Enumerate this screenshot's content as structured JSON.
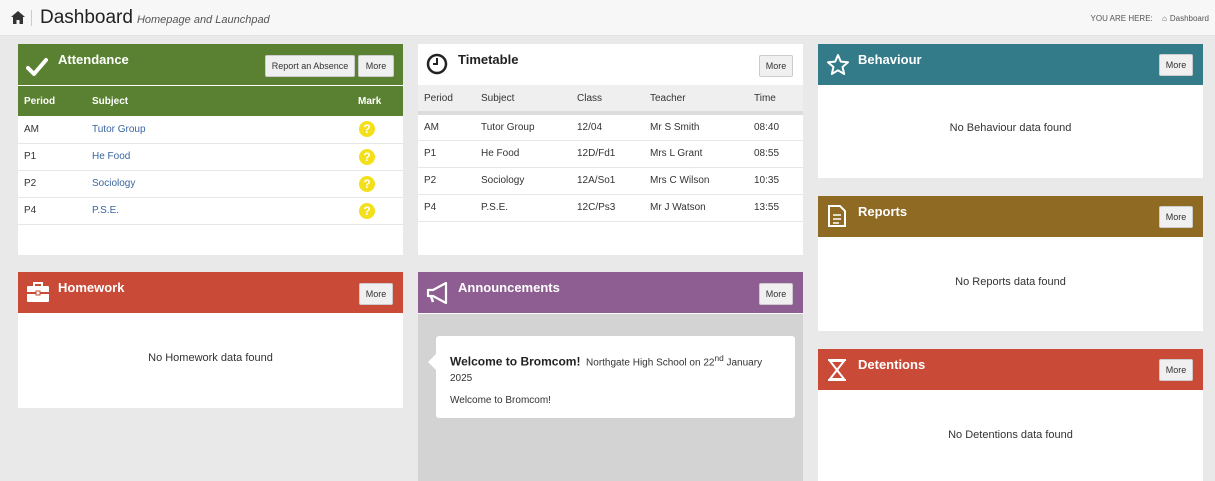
{
  "header": {
    "title": "Dashboard",
    "subtitle": "Homepage and Launchpad",
    "you_are_here": "YOU ARE HERE:",
    "crumb": "Dashboard"
  },
  "attendance": {
    "title": "Attendance",
    "report_label": "Report an Absence",
    "more_label": "More",
    "columns": [
      "Period",
      "Subject",
      "Mark"
    ],
    "rows": [
      {
        "period": "AM",
        "subject": "Tutor Group",
        "mark": "?"
      },
      {
        "period": "P1",
        "subject": "He Food",
        "mark": "?"
      },
      {
        "period": "P2",
        "subject": "Sociology",
        "mark": "?"
      },
      {
        "period": "P4",
        "subject": "P.S.E.",
        "mark": "?"
      }
    ],
    "color": "#5a8131"
  },
  "timetable": {
    "title": "Timetable",
    "more_label": "More",
    "columns": [
      "Period",
      "Subject",
      "Class",
      "Teacher",
      "Time"
    ],
    "rows": [
      {
        "period": "AM",
        "subject": "Tutor Group",
        "class": "12/04",
        "teacher": "Mr S Smith",
        "time": "08:40"
      },
      {
        "period": "P1",
        "subject": "He Food",
        "class": "12D/Fd1",
        "teacher": "Mrs L Grant",
        "time": "08:55"
      },
      {
        "period": "P2",
        "subject": "Sociology",
        "class": "12A/So1",
        "teacher": "Mrs C Wilson",
        "time": "10:35"
      },
      {
        "period": "P4",
        "subject": "P.S.E.",
        "class": "12C/Ps3",
        "teacher": "Mr J Watson",
        "time": "13:55"
      }
    ]
  },
  "behaviour": {
    "title": "Behaviour",
    "more_label": "More",
    "empty": "No Behaviour data found",
    "color": "#337b89"
  },
  "reports": {
    "title": "Reports",
    "more_label": "More",
    "empty": "No Reports data found",
    "color": "#8e6a22"
  },
  "detentions": {
    "title": "Detentions",
    "more_label": "More",
    "empty": "No Detentions data found",
    "color": "#c94a36"
  },
  "homework": {
    "title": "Homework",
    "more_label": "More",
    "empty": "No Homework data found",
    "color": "#c94a36"
  },
  "announcements": {
    "title": "Announcements",
    "more_label": "More",
    "color": "#8e5d91",
    "headline": "Welcome to Bromcom!",
    "detail_before": "Northgate High School on 22",
    "detail_sup": "nd",
    "detail_after": " January 2025",
    "body": "Welcome to Bromcom!"
  }
}
